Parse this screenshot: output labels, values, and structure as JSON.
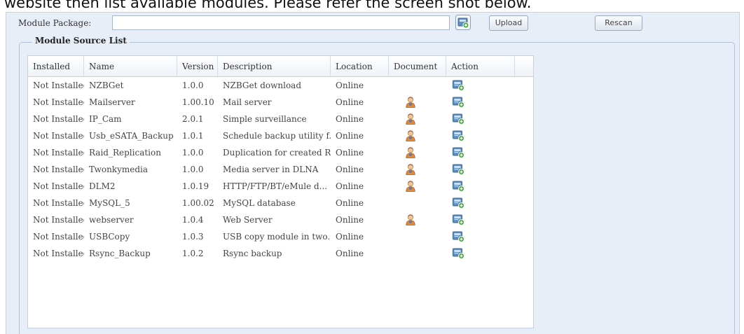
{
  "caption": "website then list available modules. Please refer the screen shot below.",
  "form": {
    "package_label": "Module Package:",
    "package_value": "",
    "upload_label": "Upload",
    "rescan_label": "Rescan"
  },
  "section": {
    "legend": "Module Source List"
  },
  "table": {
    "columns": [
      "Installed",
      "Name",
      "Version",
      "Description",
      "Location",
      "Document",
      "Action"
    ],
    "rows": [
      {
        "installed": "Not Installed",
        "name": "NZBGet",
        "version": "1.0.0",
        "description": "NZBGet download",
        "location": "Online",
        "document": false
      },
      {
        "installed": "Not Installed",
        "name": "Mailserver",
        "version": "1.00.10",
        "description": "Mail server",
        "location": "Online",
        "document": true
      },
      {
        "installed": "Not Installed",
        "name": "IP_Cam",
        "version": "2.0.1",
        "description": "Simple surveillance",
        "location": "Online",
        "document": true
      },
      {
        "installed": "Not Installed",
        "name": "Usb_eSATA_Backup",
        "version": "1.0.1",
        "description": "Schedule backup utility f...",
        "location": "Online",
        "document": true
      },
      {
        "installed": "Not Installed",
        "name": "Raid_Replication",
        "version": "1.0.0",
        "description": "Duplication for created R...",
        "location": "Online",
        "document": true
      },
      {
        "installed": "Not Installed",
        "name": "Twonkymedia",
        "version": "1.0.0",
        "description": "Media server in DLNA",
        "location": "Online",
        "document": true
      },
      {
        "installed": "Not Installed",
        "name": "DLM2",
        "version": "1.0.19",
        "description": "HTTP/FTP/BT/eMule d...",
        "location": "Online",
        "document": true
      },
      {
        "installed": "Not Installed",
        "name": "MySQL_5",
        "version": "1.00.02",
        "description": "MySQL database",
        "location": "Online",
        "document": false
      },
      {
        "installed": "Not Installed",
        "name": "webserver",
        "version": "1.0.4",
        "description": "Web Server",
        "location": "Online",
        "document": true
      },
      {
        "installed": "Not Installed",
        "name": "USBCopy",
        "version": "1.0.3",
        "description": "USB copy module in two...",
        "location": "Online",
        "document": false
      },
      {
        "installed": "Not Installed",
        "name": "Rsync_Backup",
        "version": "1.0.2",
        "description": "Rsync backup",
        "location": "Online",
        "document": false
      }
    ]
  },
  "icons": {
    "document": "user-manual-icon",
    "action": "install-module-icon",
    "package": "install-package-icon"
  },
  "colors": {
    "panel_bg": "#e8eef7",
    "border": "#c5d1e1",
    "icon_blue": "#4f7fb5",
    "icon_green": "#3fa83a",
    "doc_orange": "#e3893a"
  }
}
